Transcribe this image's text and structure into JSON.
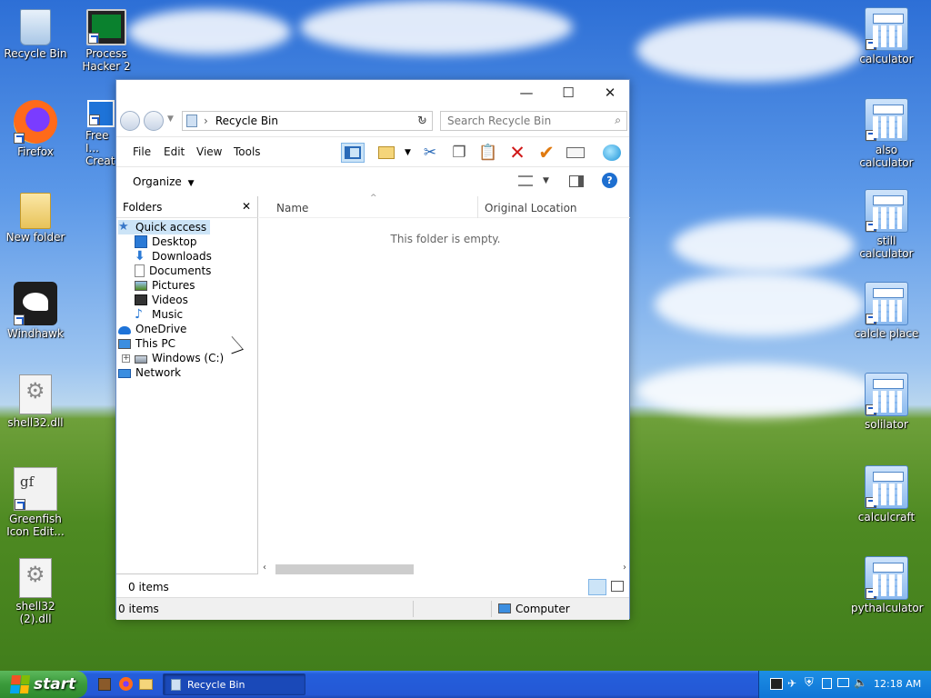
{
  "desktop": {
    "left_icons": [
      {
        "label": "Recycle Bin",
        "icon": "recycle-bin-icon"
      },
      {
        "label": "Process Hacker 2",
        "icon": "process-hacker-icon"
      },
      {
        "label": "Firefox",
        "icon": "firefox-icon"
      },
      {
        "label": "Free I... Creat...",
        "icon": "free-icon-creator-icon"
      },
      {
        "label": "New folder",
        "icon": "folder-icon"
      },
      {
        "label": "Windhawk",
        "icon": "windhawk-icon"
      },
      {
        "label": "shell32.dll",
        "icon": "dll-file-icon"
      },
      {
        "label": "Greenfish Icon Edit...",
        "icon": "greenfish-icon"
      },
      {
        "label": "shell32 (2).dll",
        "icon": "dll-file-icon"
      }
    ],
    "right_icons": [
      {
        "label": "calculator"
      },
      {
        "label": "also calculator"
      },
      {
        "label": "still calculator"
      },
      {
        "label": "calcle place"
      },
      {
        "label": "solilator"
      },
      {
        "label": "calculcraft"
      },
      {
        "label": "pythalculator"
      }
    ]
  },
  "window": {
    "title_buttons": {
      "minimize": "—",
      "maximize": "☐",
      "close": "✕"
    },
    "address": {
      "breadcrumb_sep": "›",
      "location": "Recycle Bin"
    },
    "search": {
      "placeholder": "Search Recycle Bin"
    },
    "menu": {
      "file": "File",
      "edit": "Edit",
      "view": "View",
      "tools": "Tools"
    },
    "organize": "Organize",
    "folders_pane": {
      "title": "Folders",
      "close": "✕",
      "items": [
        {
          "label": "Quick access",
          "icon": "star-icon",
          "level": 0,
          "selected": true
        },
        {
          "label": "Desktop",
          "icon": "desktop-icon",
          "level": 1
        },
        {
          "label": "Downloads",
          "icon": "download-icon",
          "level": 1
        },
        {
          "label": "Documents",
          "icon": "document-icon",
          "level": 1
        },
        {
          "label": "Pictures",
          "icon": "pictures-icon",
          "level": 1
        },
        {
          "label": "Videos",
          "icon": "videos-icon",
          "level": 1
        },
        {
          "label": "Music",
          "icon": "music-icon",
          "level": 1
        },
        {
          "label": "OneDrive",
          "icon": "cloud-icon",
          "level": 0
        },
        {
          "label": "This PC",
          "icon": "computer-icon",
          "level": 0
        },
        {
          "label": "Windows (C:)",
          "icon": "drive-icon",
          "level": 1
        },
        {
          "label": "Network",
          "icon": "network-icon",
          "level": 0
        }
      ]
    },
    "columns": {
      "name": "Name",
      "original_location": "Original Location"
    },
    "empty_message": "This folder is empty.",
    "status_items": "0 items",
    "status_bottom_items": "0 items",
    "status_location": "Computer"
  },
  "taskbar": {
    "start_label": "start",
    "task_label": "Recycle Bin",
    "clock": "12:18 AM"
  },
  "colors": {
    "taskbar_blue": "#245edb",
    "start_green": "#3a9a3a",
    "selection": "#cce4f7",
    "delete_red": "#d01818",
    "check_orange": "#e07a10"
  }
}
